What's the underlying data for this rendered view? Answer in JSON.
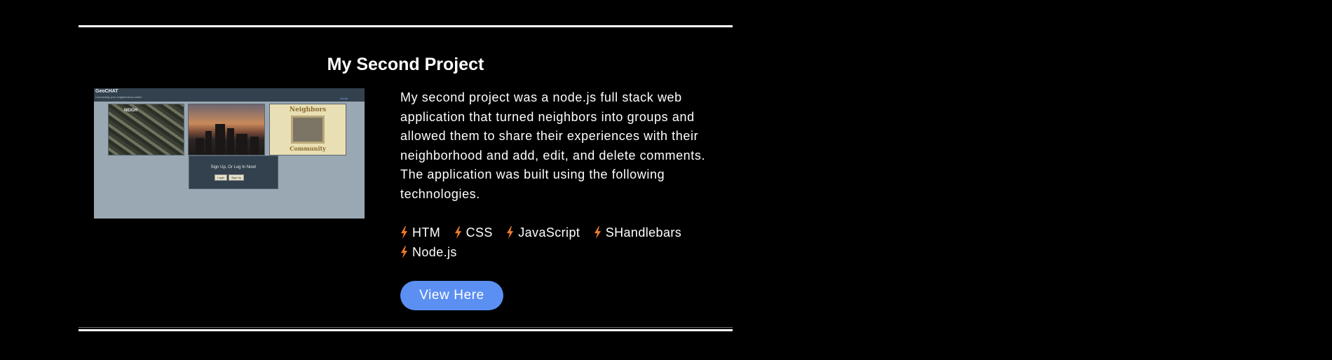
{
  "project": {
    "title": "My Second Project",
    "description": "My second project was a node.js full stack web application that turned neighbors into groups and allowed them to share their experiences with their neighborhood and add, edit, and delete comments. The application was built using the following technologies.",
    "technologies": [
      {
        "label": "HTM",
        "icon": "bolt-icon"
      },
      {
        "label": "CSS",
        "icon": "bolt-icon"
      },
      {
        "label": "JavaScript",
        "icon": "bolt-icon"
      },
      {
        "label": "SHandlebars",
        "icon": "bolt-icon"
      },
      {
        "label": "Node.js",
        "icon": "bolt-icon"
      }
    ],
    "button_label": "View Here"
  },
  "screenshot": {
    "brand": "GeoCHAT",
    "tagline": "Connecting your neighborhood online",
    "nav_text": "Home",
    "tile1_label": "NEIGH",
    "tile3_sign_top": "Neighbors",
    "tile3_sign_bottom": "Community",
    "login_prompt": "Sign Up, Or Log In Now!",
    "login_button": "Login",
    "signup_button": "Sign Up"
  },
  "colors": {
    "background": "#000000",
    "text": "#ffffff",
    "accent_button": "#5b8ff2",
    "bolt": "#f07a2a"
  }
}
